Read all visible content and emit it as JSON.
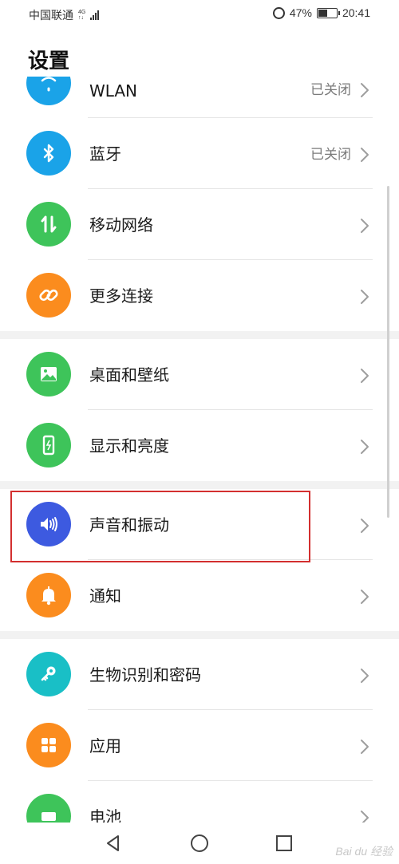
{
  "status_bar": {
    "carrier": "中国联通",
    "net_type_top": "4G",
    "net_type_bottom": "↑↓",
    "battery_percent": "47%",
    "battery_level": 0.47,
    "time": "20:41"
  },
  "page": {
    "title": "设置"
  },
  "groups": [
    {
      "items": [
        {
          "id": "wlan",
          "label": "WLAN",
          "value": "已关闭",
          "icon": "wifi-icon",
          "color": "#1aa3e8",
          "partial": true
        },
        {
          "id": "bluetooth",
          "label": "蓝牙",
          "value": "已关闭",
          "icon": "bluetooth-icon",
          "color": "#1aa3e8"
        },
        {
          "id": "mobile-network",
          "label": "移动网络",
          "value": "",
          "icon": "mobile-data-icon",
          "color": "#3ec45a"
        },
        {
          "id": "more-connections",
          "label": "更多连接",
          "value": "",
          "icon": "link-icon",
          "color": "#fb8c1e"
        }
      ]
    },
    {
      "items": [
        {
          "id": "wallpaper",
          "label": "桌面和壁纸",
          "value": "",
          "icon": "image-icon",
          "color": "#3ec45a"
        },
        {
          "id": "display",
          "label": "显示和亮度",
          "value": "",
          "icon": "phone-brightness-icon",
          "color": "#3ec45a"
        }
      ]
    },
    {
      "items": [
        {
          "id": "sound",
          "label": "声音和振动",
          "value": "",
          "icon": "speaker-icon",
          "color": "#3d5ae0"
        },
        {
          "id": "notifications",
          "label": "通知",
          "value": "",
          "icon": "bell-icon",
          "color": "#fb8c1e"
        }
      ]
    },
    {
      "items": [
        {
          "id": "biometrics",
          "label": "生物识别和密码",
          "value": "",
          "icon": "key-icon",
          "color": "#19bfc6"
        },
        {
          "id": "apps",
          "label": "应用",
          "value": "",
          "icon": "grid-icon",
          "color": "#fb8c1e"
        },
        {
          "id": "battery",
          "label": "电池",
          "value": "",
          "icon": "battery-icon",
          "color": "#3ec45a"
        }
      ]
    }
  ],
  "watermark": "Bai du 经验",
  "colors": {
    "highlight": "#d32f2f",
    "chevron": "#9e9e9e"
  }
}
